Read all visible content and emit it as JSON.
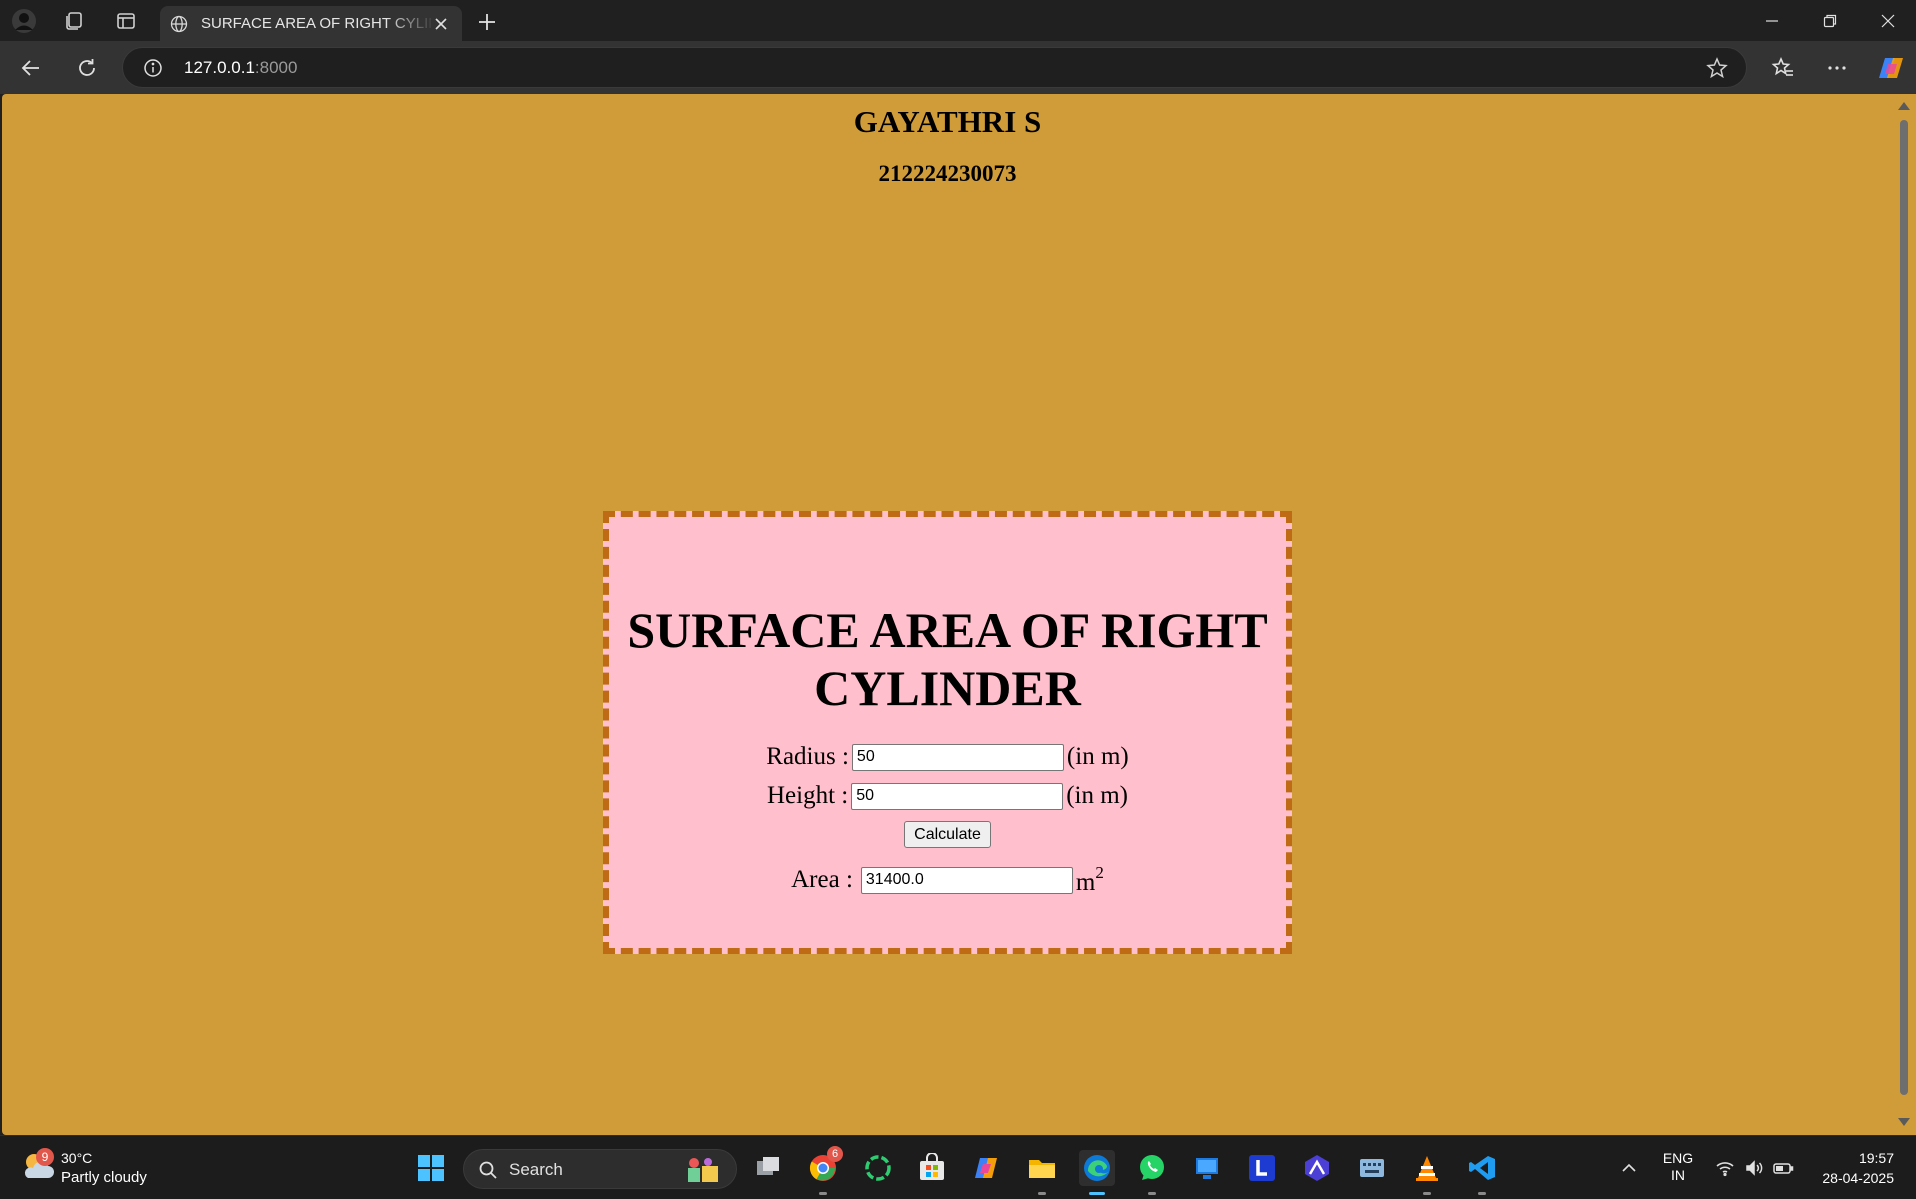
{
  "browser": {
    "tab_title": "SURFACE AREA OF RIGHT CYLINDER",
    "url_host": "127.0.0.1",
    "url_port": ":8000"
  },
  "page": {
    "author_name": "GAYATHRI S",
    "register_number": "212224230073",
    "title": "SURFACE AREA OF RIGHT CYLINDER",
    "form": {
      "radius_label": "Radius :",
      "radius_value": "50",
      "radius_unit": "(in m)",
      "height_label": "Height :",
      "height_value": "50",
      "height_unit": "(in m)",
      "calculate_label": "Calculate",
      "area_label": "Area :",
      "area_value": "31400.0",
      "area_unit": "m",
      "area_unit_exponent": "2"
    },
    "colors": {
      "background": "#d09c3a",
      "card_background": "#ffbfcc",
      "card_border": "#bf6b16"
    }
  },
  "taskbar": {
    "weather_temp": "30°C",
    "weather_desc": "Partly cloudy",
    "weather_badge": "9",
    "search_label": "Search",
    "chrome_badge": "6",
    "language_line1": "ENG",
    "language_line2": "IN",
    "time": "19:57",
    "date": "28-04-2025",
    "apps": [
      "task-view",
      "chrome",
      "refresh-app",
      "microsoft-store",
      "copilot",
      "file-explorer",
      "edge",
      "whatsapp",
      "windows-app",
      "l-app",
      "affinity-app",
      "keyboard-app",
      "vlc",
      "vscode"
    ]
  }
}
